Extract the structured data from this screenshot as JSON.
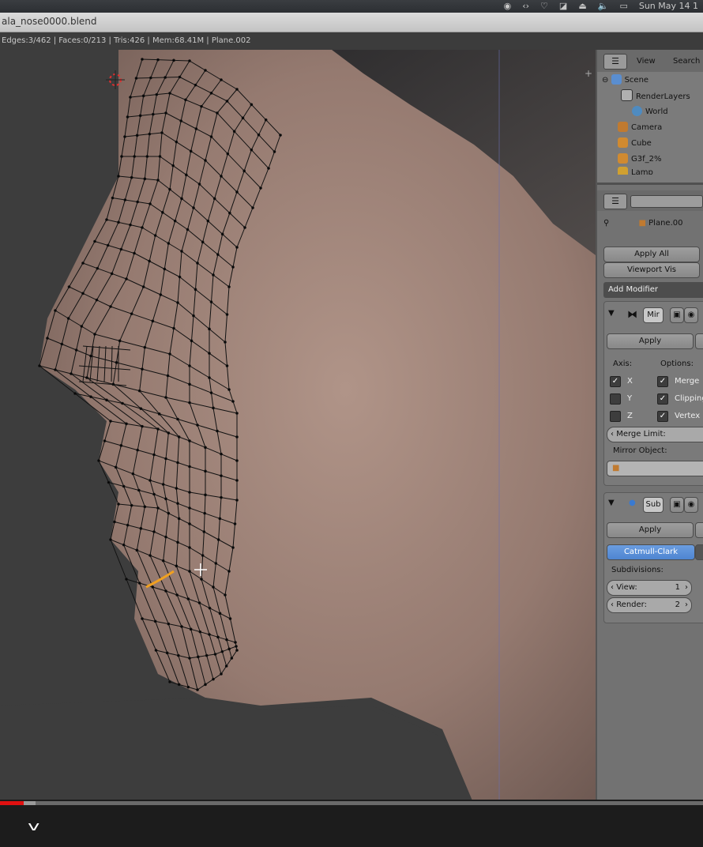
{
  "system_bar": {
    "clock": "Sun May 14 1",
    "icons": [
      "record-icon",
      "code-icon",
      "heart-icon",
      "cast-icon",
      "upload-icon",
      "volume-icon",
      "keyboard-icon"
    ]
  },
  "window": {
    "title": "ala_nose0000.blend"
  },
  "info": {
    "stats": "Edges:3/462 | Faces:0/213 | Tris:426 | Mem:68.41M | Plane.002"
  },
  "outliner": {
    "menu": [
      "View",
      "Search"
    ],
    "items": [
      {
        "label": "Scene",
        "icon": "scene-icon"
      },
      {
        "label": "RenderLayers",
        "icon": "renderlayers-icon"
      },
      {
        "label": "World",
        "icon": "world-icon"
      },
      {
        "label": "Camera",
        "icon": "camera-icon"
      },
      {
        "label": "Cube",
        "icon": "mesh-icon"
      },
      {
        "label": "G3f_2%",
        "icon": "mesh-icon"
      },
      {
        "label": "Lamp",
        "icon": "lamp-icon"
      }
    ]
  },
  "properties": {
    "object_name": "Plane.00",
    "apply_all": "Apply All",
    "viewport_vis": "Viewport Vis",
    "add_modifier": "Add Modifier",
    "mirror": {
      "name": "Mir",
      "apply": "Apply",
      "axis_label": "Axis:",
      "options_label": "Options:",
      "axes": [
        {
          "label": "X",
          "checked": true
        },
        {
          "label": "Y",
          "checked": false
        },
        {
          "label": "Z",
          "checked": false
        }
      ],
      "options": [
        {
          "label": "Merge",
          "checked": true
        },
        {
          "label": "Clipping",
          "checked": true
        },
        {
          "label": "Vertex",
          "checked": true
        }
      ],
      "merge_limit": "Merge Limit:",
      "mirror_object": "Mirror Object:"
    },
    "subsurf": {
      "name": "Sub",
      "apply": "Apply",
      "mode": "Catmull-Clark",
      "subdivisions_label": "Subdivisions:",
      "view_label": "View:",
      "view_value": "1",
      "render_label": "Render:",
      "render_value": "2"
    }
  },
  "video": {
    "played_fraction": 0.034,
    "loaded_fraction": 0.05
  }
}
